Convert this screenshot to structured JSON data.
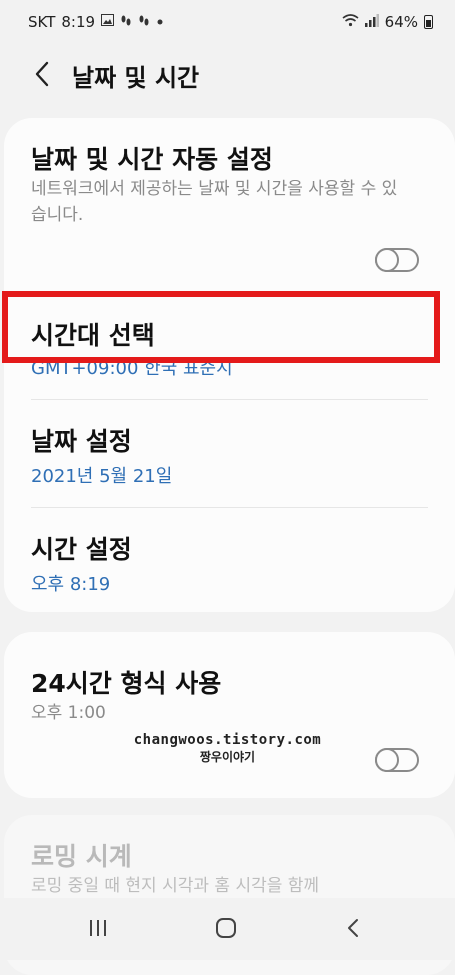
{
  "status_bar": {
    "carrier": "SKT",
    "time": "8:19",
    "battery": "64%"
  },
  "header": {
    "title": "날짜 및 시간"
  },
  "settings": {
    "auto_datetime": {
      "title": "날짜 및 시간 자동 설정",
      "description": "네트워크에서 제공하는 날짜 및 시간을 사용할 수 있습니다."
    },
    "timezone": {
      "title": "시간대 선택",
      "value": "GMT+09:00 한국 표준시"
    },
    "date": {
      "title": "날짜 설정",
      "value": "2021년 5월 21일"
    },
    "time": {
      "title": "시간 설정",
      "value": "오후 8:19"
    },
    "hour24": {
      "title": "24시간 형식 사용",
      "value": "오후 1:00"
    },
    "roaming": {
      "title": "로밍 시계",
      "description": "로밍 중일 때 현지 시각과 홈 시각을 함께"
    }
  },
  "watermark": {
    "line1": "changwoos.tistory.com",
    "line2": "짱우이야기"
  },
  "colors": {
    "accent_value": "#2f6fb5",
    "highlight_border": "#e41a1a",
    "background": "#f2f2f2",
    "card": "#fcfcfc"
  },
  "icons": {
    "back": "chevron-left-icon",
    "nav_recent": "recent-apps-icon",
    "nav_home": "home-icon",
    "nav_back": "back-icon"
  }
}
